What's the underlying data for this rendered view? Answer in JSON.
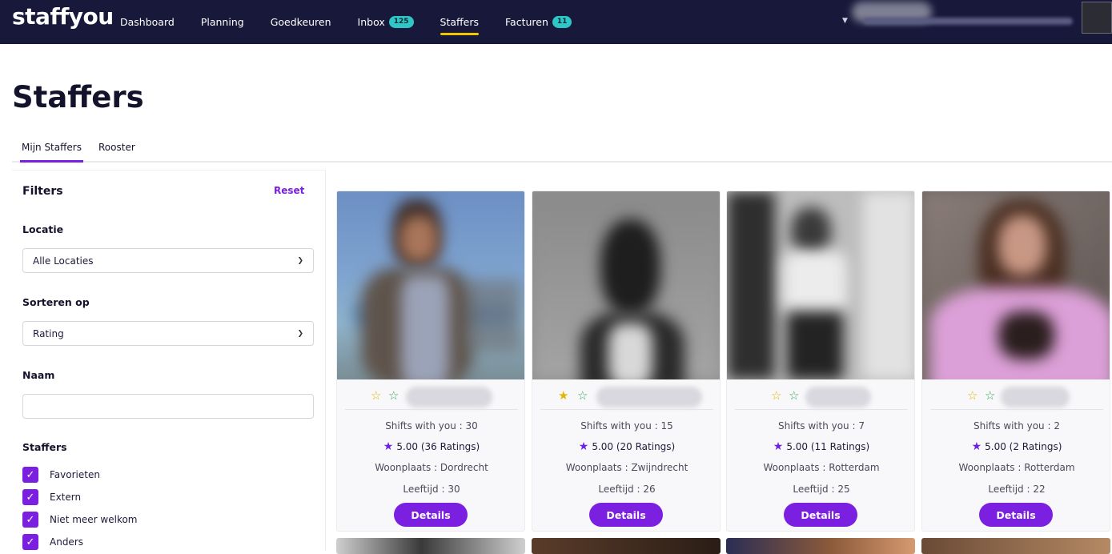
{
  "brand": {
    "logo": "staffyou"
  },
  "nav": {
    "items": [
      {
        "label": "Dashboard",
        "active": false
      },
      {
        "label": "Planning",
        "active": false
      },
      {
        "label": "Goedkeuren",
        "active": false
      },
      {
        "label": "Inbox",
        "badge": "125",
        "active": false
      },
      {
        "label": "Staffers",
        "active": true
      },
      {
        "label": "Facturen",
        "badge": "11",
        "active": false
      }
    ]
  },
  "page": {
    "title": "Staffers"
  },
  "tabs": [
    {
      "label": "Mijn Staffers",
      "active": true
    },
    {
      "label": "Rooster",
      "active": false
    }
  ],
  "filters": {
    "title": "Filters",
    "reset_label": "Reset",
    "location_label": "Locatie",
    "location_value": "Alle Locaties",
    "sort_label": "Sorteren op",
    "sort_value": "Rating",
    "name_label": "Naam",
    "name_value": "",
    "staffers_label": "Staffers",
    "checkboxes": [
      {
        "label": "Favorieten",
        "checked": true
      },
      {
        "label": "Extern",
        "checked": true
      },
      {
        "label": "Niet meer welkom",
        "checked": true
      },
      {
        "label": "Anders",
        "checked": true
      }
    ]
  },
  "cards": [
    {
      "shifts": "Shifts with you : 30",
      "rating": "5.00 (36 Ratings)",
      "city": "Woonplaats : Dordrecht",
      "age": "Leeftijd : 30",
      "button": "Details",
      "first_star_filled": false
    },
    {
      "shifts": "Shifts with you : 15",
      "rating": "5.00 (20 Ratings)",
      "city": "Woonplaats : Zwijndrecht",
      "age": "Leeftijd : 26",
      "button": "Details",
      "first_star_filled": true
    },
    {
      "shifts": "Shifts with you : 7",
      "rating": "5.00 (11 Ratings)",
      "city": "Woonplaats : Rotterdam",
      "age": "Leeftijd : 25",
      "button": "Details",
      "first_star_filled": false
    },
    {
      "shifts": "Shifts with you : 2",
      "rating": "5.00 (2 Ratings)",
      "city": "Woonplaats : Rotterdam",
      "age": "Leeftijd : 22",
      "button": "Details",
      "first_star_filled": false
    }
  ],
  "colors": {
    "accent": "#7b20e0",
    "nav_bg": "#17183a",
    "badge": "#2ec6c6",
    "active_underline": "#f5c400",
    "favorite_star": "#e3b600"
  },
  "icons": {
    "rating": "star-icon",
    "favorite": "star-outline-icon",
    "checkbox": "check-icon",
    "select": "chevron-down-icon"
  }
}
